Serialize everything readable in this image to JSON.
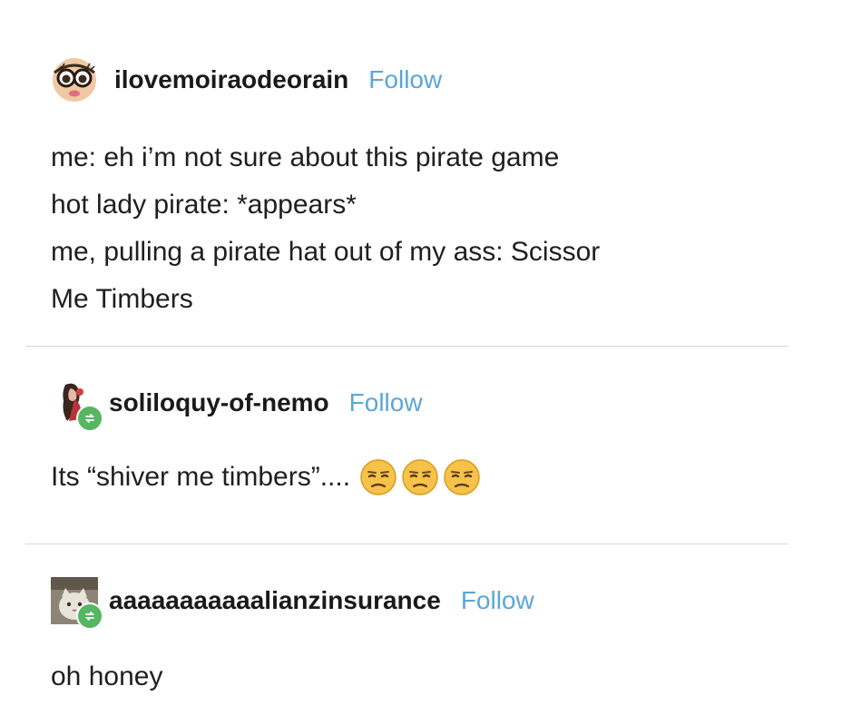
{
  "posts": [
    {
      "username": "ilovemoiraodeorain",
      "follow_label": "Follow",
      "lines": [
        "me: eh i’m not sure about this pirate game",
        "hot lady pirate: *appears*",
        "me, pulling a pirate hat out of my ass: Scissor",
        "Me Timbers"
      ]
    },
    {
      "username": "soliloquy-of-nemo",
      "follow_label": "Follow",
      "lines": [
        "Its “shiver me timbers”...."
      ]
    },
    {
      "username": "aaaaaaaaaaalianzinsurance",
      "follow_label": "Follow",
      "lines": [
        "oh honey"
      ]
    }
  ],
  "icons": {
    "reblog": "reblog-icon",
    "unamused_face": "unamused-face-icon"
  },
  "colors": {
    "follow": "#5aa7d9",
    "reblog_badge": "#56b661",
    "divider": "#d6d6d6",
    "text": "#1f1f1f"
  }
}
